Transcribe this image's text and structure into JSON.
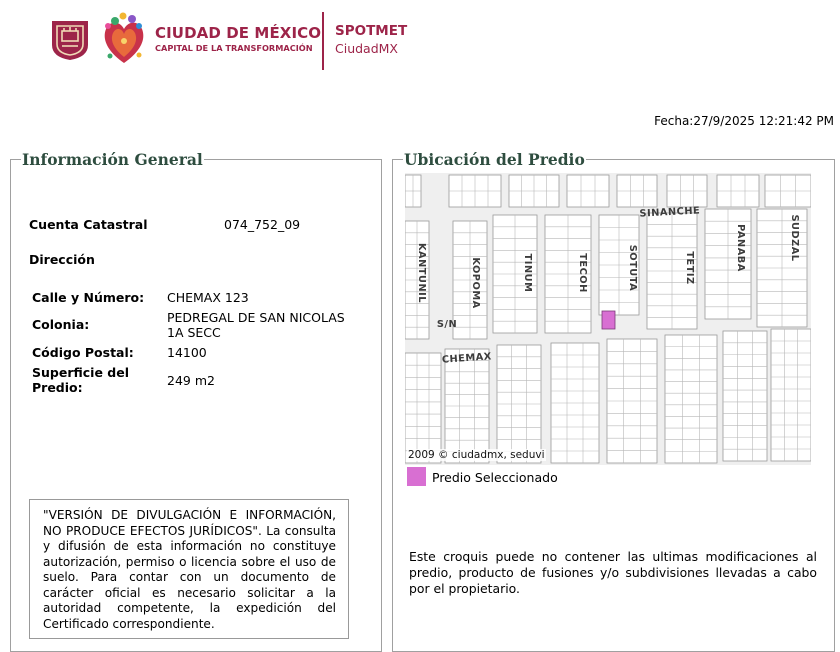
{
  "header": {
    "brand_title": "CIUDAD DE MÉXICO",
    "brand_subtitle": "CAPITAL DE LA TRANSFORMACIÓN",
    "app_title": "SPOTMET",
    "app_subtitle": "CiudadMX",
    "brand_color": "#9d2449"
  },
  "fecha": "Fecha:27/9/2025 12:21:42 PM",
  "info_general": {
    "legend": "Información General",
    "cuenta_label": "Cuenta Catastral",
    "cuenta_value": "074_752_09",
    "direccion_label": "Dirección",
    "calle_label": "Calle y Número:",
    "calle_value": "CHEMAX 123",
    "colonia_label": "Colonia:",
    "colonia_value_line1": "PEDREGAL DE SAN NICOLAS",
    "colonia_value_line2": "1A SECC",
    "cp_label": "Código Postal:",
    "cp_value": "14100",
    "superficie_label_line1": "Superficie del",
    "superficie_label_line2": "Predio:",
    "superficie_value": "249 m2",
    "notice": "\"VERSIÓN DE DIVULGACIÓN E INFORMACIÓN, NO PRODUCE EFECTOS JURÍDICOS\". La consulta y difusión de esta información no constituye autorización, permiso o licencia sobre el uso de suelo. Para contar con un documento de carácter oficial es necesario solicitar a la autoridad competente, la expedición del Certificado correspondiente."
  },
  "ubicacion": {
    "legend": "Ubicación del Predio",
    "map_copyright": "2009 © ciudadmx, seduvi",
    "streets": [
      "KANTUNIL",
      "KOPOMA",
      "TINUM",
      "TECOH",
      "SOTUTA",
      "TETIZ",
      "PANABA",
      "SUDZAL",
      "SINANCHE",
      "CHEMAX",
      "S/N"
    ],
    "legend_label": "Predio Seleccionado",
    "selected_color": "#d86fd2",
    "disclaimer": "Este croquis puede no contener las ultimas modificaciones al predio, producto de fusiones y/o subdivisiones llevadas a cabo por el propietario."
  }
}
